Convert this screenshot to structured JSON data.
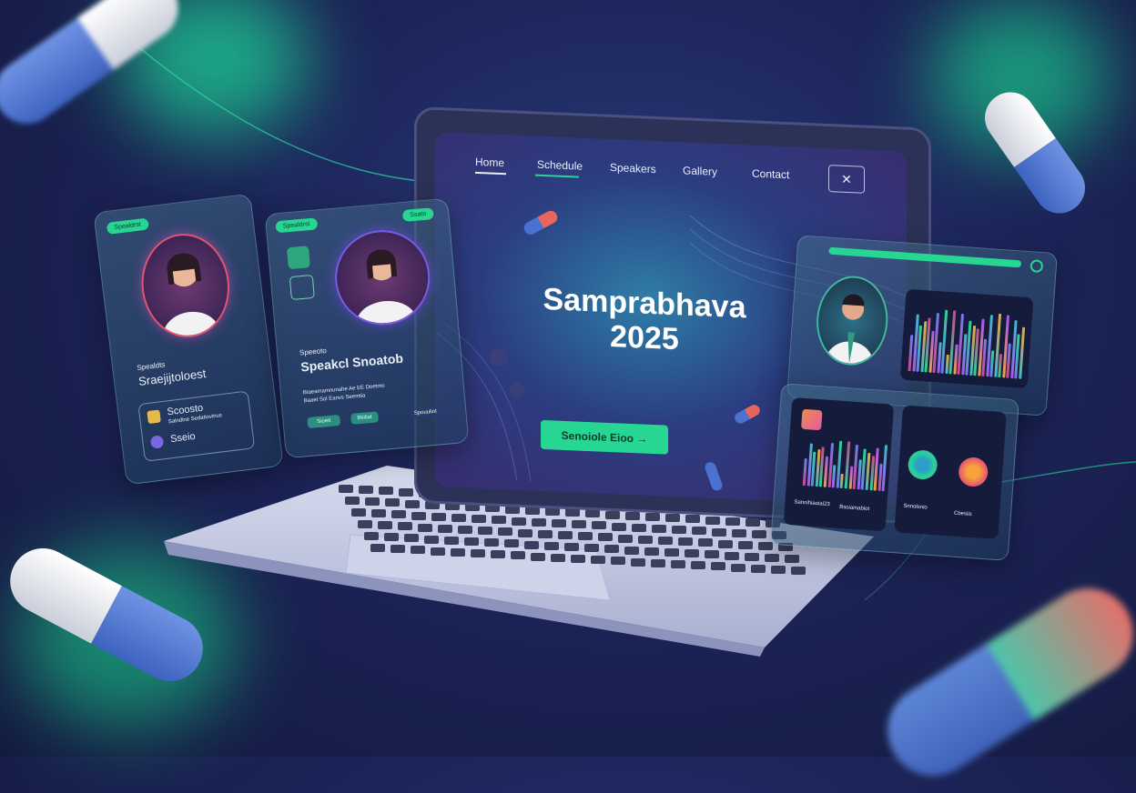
{
  "nav": {
    "home": "Home",
    "schedule": "Schedule",
    "speakers": "Speakers",
    "gallery": "Gallery",
    "contact": "Contact"
  },
  "hero": {
    "title_line1": "Samprabhava",
    "title_line2": "2025",
    "cta_label": "Senoiole Eioo"
  },
  "left_card": {
    "badge": "Spealdrst",
    "subtitle": "Spealdts",
    "name": "Sraejijtoloest",
    "row1": "Scoosto",
    "row1_sub": "Salndine Sedatiovinus",
    "row2": "Sseio"
  },
  "mid_card": {
    "badge": "Spealdrst",
    "badge2": "Ssato",
    "subtitle": "Speeoto",
    "name": "Speakcl Snoatob",
    "desc1": "Btaeamamnunahe Ae EE Doetmo",
    "desc2": "Baaet Sol Eanvs Seemtia",
    "btn1": "Sioeit",
    "btn2": "Bkiliat",
    "btn3": "Spouuliot"
  },
  "right_panel": {
    "caption1": "Sannihiaoiai23",
    "caption2": "Bsoiamabiot",
    "caption3": "Snnolsnio",
    "caption4": "Cbesiis"
  },
  "colors": {
    "accent": "#27d693",
    "bg": "#1c2458",
    "pill_blue": "#4a72cf"
  }
}
